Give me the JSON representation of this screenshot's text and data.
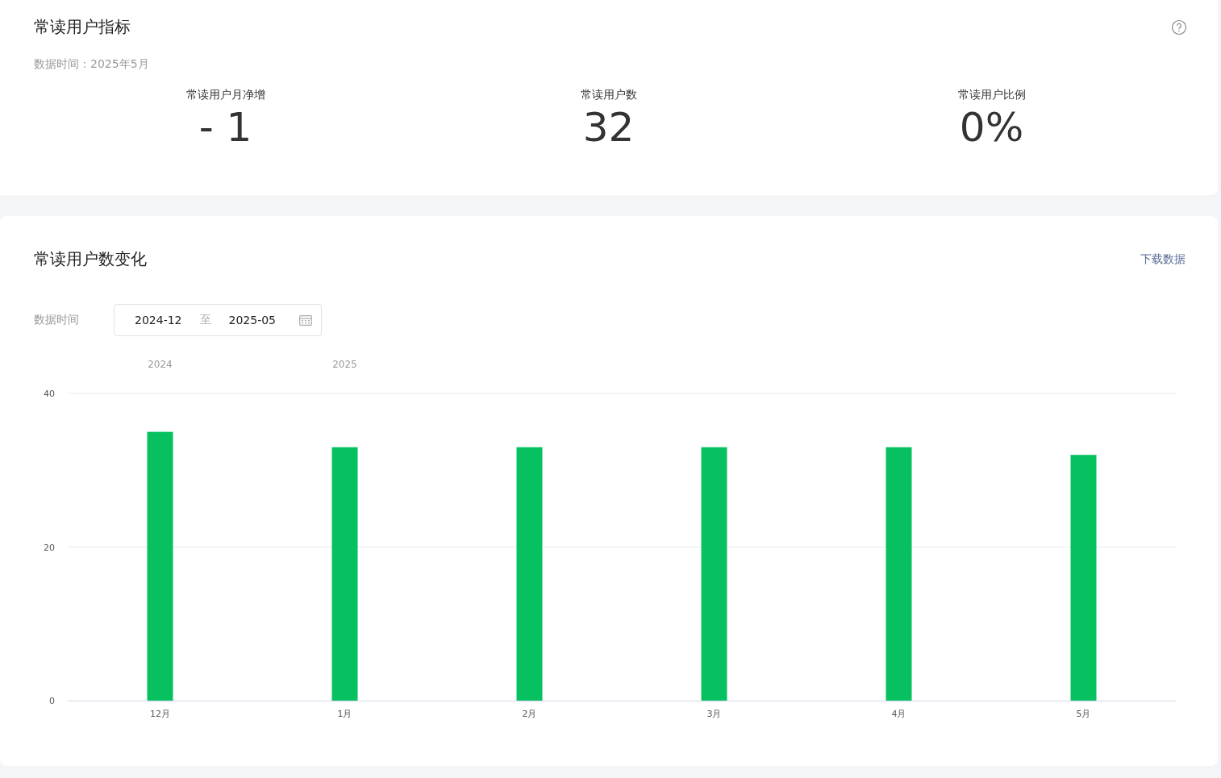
{
  "metrics_card": {
    "title": "常读用户指标",
    "data_time": "数据时间：2025年5月",
    "metrics": [
      {
        "label": "常读用户月净增",
        "value": "- 1"
      },
      {
        "label": "常读用户数",
        "value": "32"
      },
      {
        "label": "常读用户比例",
        "value": "0%"
      }
    ]
  },
  "trend_card": {
    "title": "常读用户数变化",
    "download_link": "下载数据",
    "filter_label": "数据时间",
    "date_range": {
      "start": "2024-12",
      "separator": "至",
      "end": "2025-05"
    },
    "chart_data": {
      "type": "bar",
      "categories": [
        "12月",
        "1月",
        "2月",
        "3月",
        "4月",
        "5月"
      ],
      "series": [
        {
          "color": "#07c160",
          "values": [
            35,
            33,
            33,
            33,
            33,
            32
          ]
        }
      ],
      "ylim": [
        0,
        40
      ],
      "yticks": [
        0,
        20,
        40
      ],
      "annotations": [
        "2024",
        "2025"
      ]
    }
  }
}
